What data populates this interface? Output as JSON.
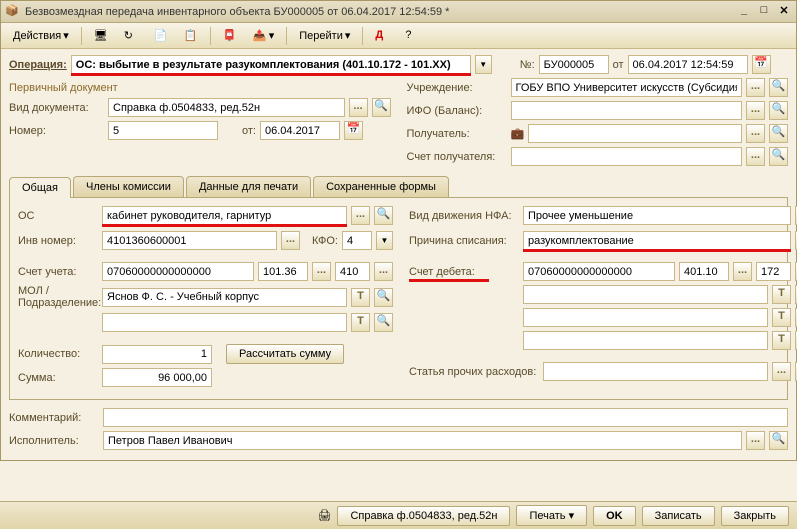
{
  "titlebar": {
    "title": "Безвозмездная передача инвентарного объекта БУ000005 от 06.04.2017 12:54:59 *"
  },
  "toolbar": {
    "actions": "Действия",
    "goto": "Перейти"
  },
  "opRow": {
    "label": "Операция:",
    "value": "ОС: выбытие в результате разукомплектования (401.10.172 - 101.XX)",
    "numLabel": "№:",
    "num": "БУ000005",
    "otLabel": "от",
    "date": "06.04.2017 12:54:59"
  },
  "left": {
    "primaryDoc": "Первичный документ",
    "vidDokLabel": "Вид документа:",
    "vidDok": "Справка ф.0504833, ред.52н",
    "nomerLabel": "Номер:",
    "nomer": "5",
    "otLabel": "от:",
    "ot": "06.04.2017"
  },
  "right": {
    "uchrLabel": "Учреждение:",
    "uchr": "ГОБУ ВПО Университет искусств (Субсидия)",
    "ifoLabel": "ИФО (Баланс):",
    "ifo": "",
    "poluchLabel": "Получатель:",
    "poluch": "",
    "schetLabel": "Счет получателя:",
    "schet": ""
  },
  "tabs": [
    "Общая",
    "Члены комиссии",
    "Данные для печати",
    "Сохраненные формы"
  ],
  "general": {
    "osLabel": "ОС",
    "os": "кабинет руководителя, гарнитур",
    "invLabel": "Инв номер:",
    "inv": "4101360600001",
    "kfoLabel": "КФО:",
    "kfo": "4",
    "schetUchLabel": "Счет учета:",
    "schetUch1": "07060000000000000",
    "schetUch2": "101.36",
    "schetUch3": "410",
    "molLabel": "МОЛ / Подразделение:",
    "mol": "Яснов Ф. С. - Учебный корпус",
    "kolLabel": "Количество:",
    "kol": "1",
    "rasschBtn": "Рассчитать сумму",
    "summaLabel": "Сумма:",
    "summa": "96 000,00",
    "vidDvLabel": "Вид движения НФА:",
    "vidDv": "Прочее уменьшение",
    "prichLabel": "Причина списания:",
    "prich": "разукомплектование",
    "schetDebLabel": "Счет дебета:",
    "schetDeb1": "07060000000000000",
    "schetDeb2": "401.10",
    "schetDeb3": "172",
    "statyaLabel": "Статья прочих расходов:"
  },
  "bottom": {
    "kommLabel": "Комментарий:",
    "komm": "",
    "ispLabel": "Исполнитель:",
    "isp": "Петров Павел Иванович"
  },
  "footer": {
    "spravka": "Справка ф.0504833, ред.52н",
    "pechat": "Печать",
    "ok": "OK",
    "zapisat": "Записать",
    "zakryt": "Закрыть"
  }
}
